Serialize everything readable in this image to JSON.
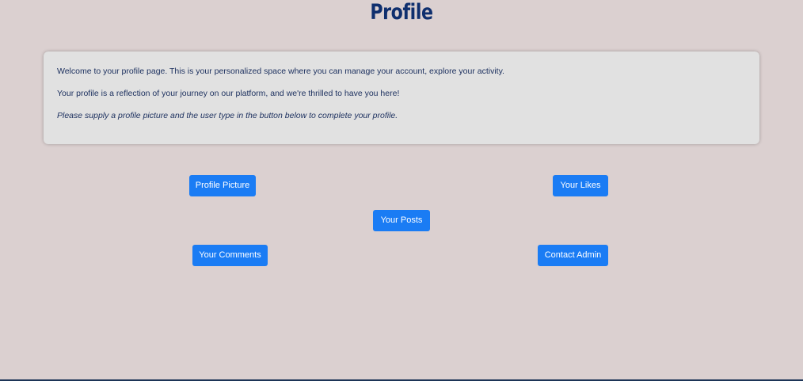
{
  "page": {
    "title": "Profile"
  },
  "intro": {
    "paragraph_1": "Welcome to your profile page. This is your personalized space where you can manage your account, explore your activity.",
    "paragraph_2": "Your profile is a reflection of your journey on our platform, and we're thrilled to have you here!",
    "paragraph_3": "Please supply a profile picture and the user type in the button below to complete your profile."
  },
  "buttons": {
    "profile_picture": "Profile Picture",
    "your_likes": "Your Likes",
    "your_posts": "Your Posts",
    "your_comments": "Your Comments",
    "contact_admin": "Contact Admin"
  },
  "colors": {
    "background": "#dbd0d0",
    "title": "#0f2f6e",
    "card_background": "#e1e1e1",
    "card_text": "#1b2f5e",
    "button_background": "#1a7cf4",
    "button_text": "#ffffff"
  }
}
